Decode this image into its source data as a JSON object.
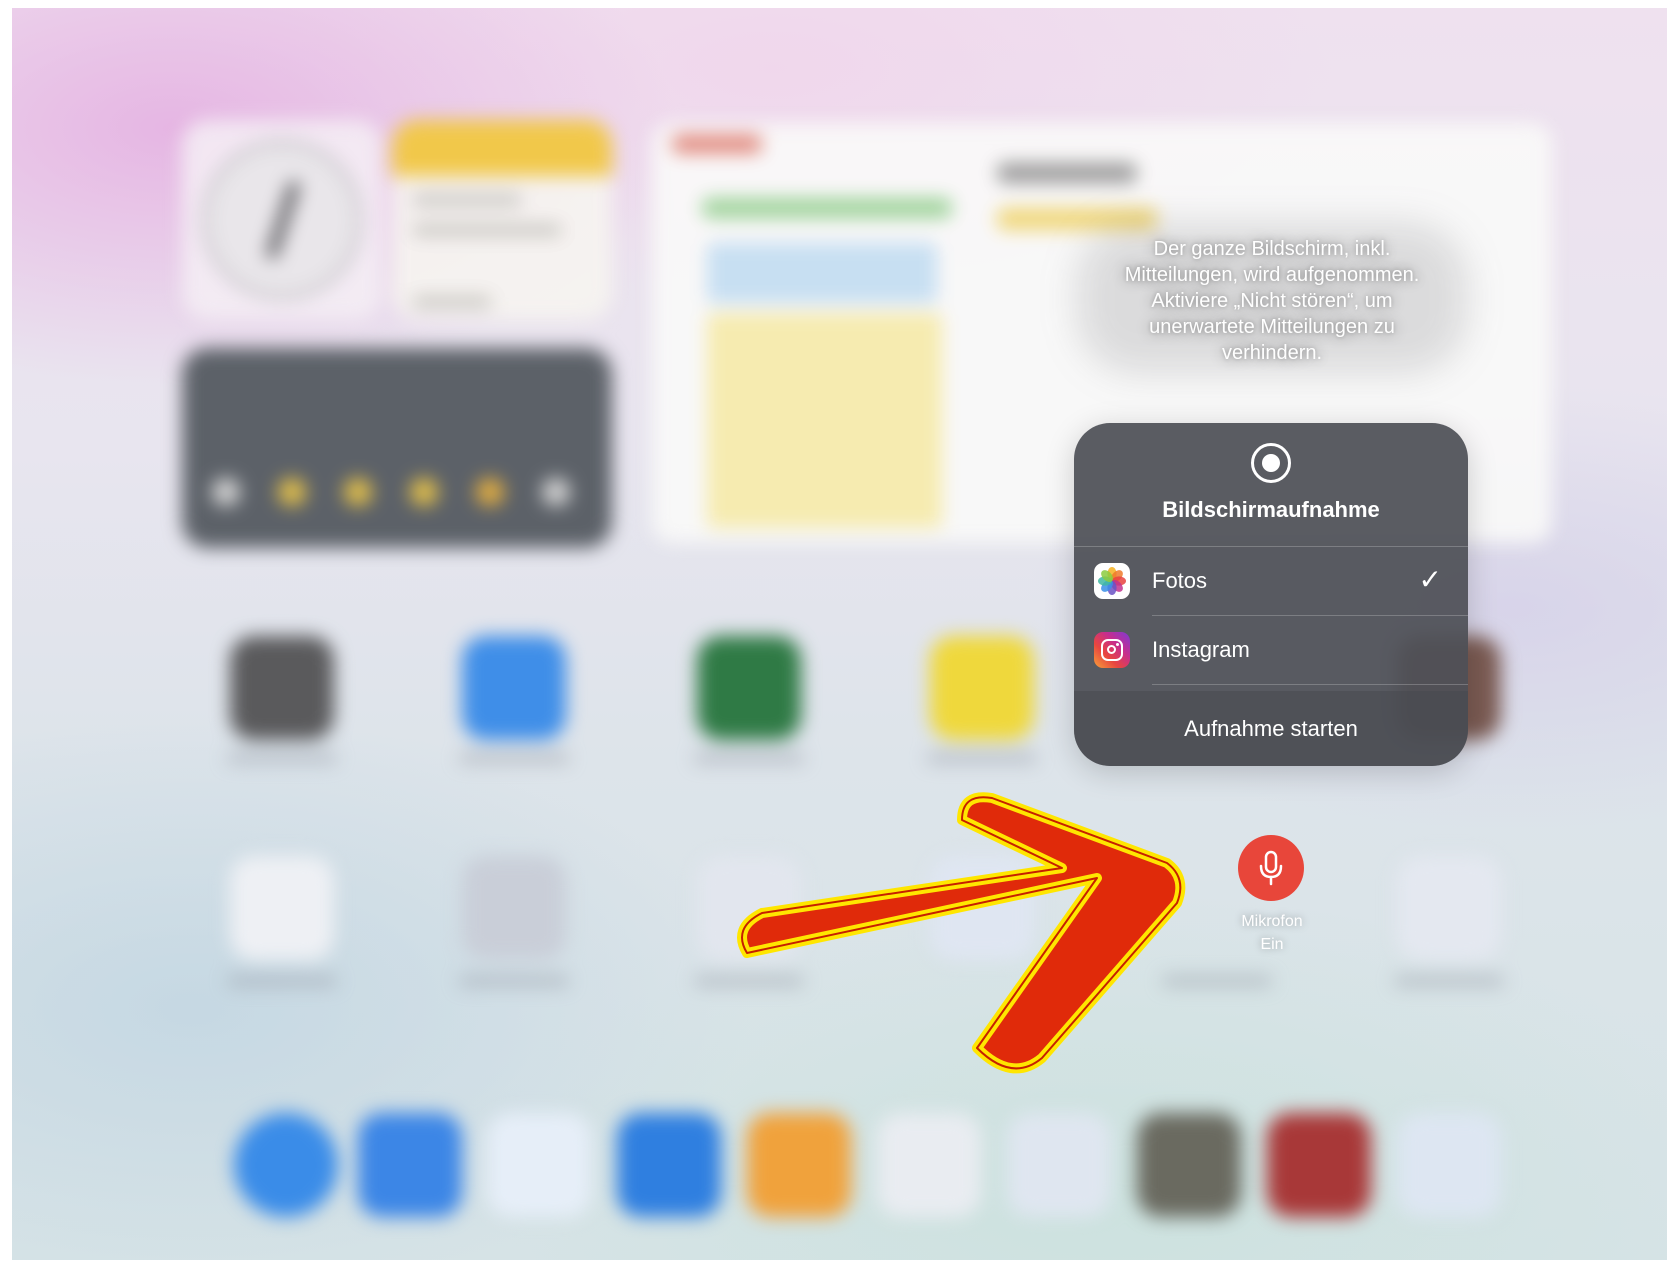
{
  "info_text": {
    "line1": "Der ganze Bildschirm, inkl.",
    "line2": "Mitteilungen, wird aufgenommen.",
    "line3": "Aktiviere „Nicht stören“, um",
    "line4": "unerwartete Mitteilungen zu",
    "line5": "verhindern."
  },
  "panel": {
    "title": "Bildschirmaufnahme",
    "record_icon": "record-icon",
    "options": [
      {
        "label": "Fotos",
        "icon": "photos-app-icon",
        "selected": true,
        "check": "✓"
      },
      {
        "label": "Instagram",
        "icon": "instagram-app-icon",
        "selected": false,
        "check": ""
      }
    ],
    "start_label": "Aufnahme starten"
  },
  "microphone": {
    "label_line1": "Mikrofon",
    "label_line2": "Ein",
    "icon": "microphone-icon",
    "active_color": "#e8463a"
  },
  "annotation": {
    "arrow_fill": "#e02a0a",
    "arrow_outline": "#ffe600"
  }
}
